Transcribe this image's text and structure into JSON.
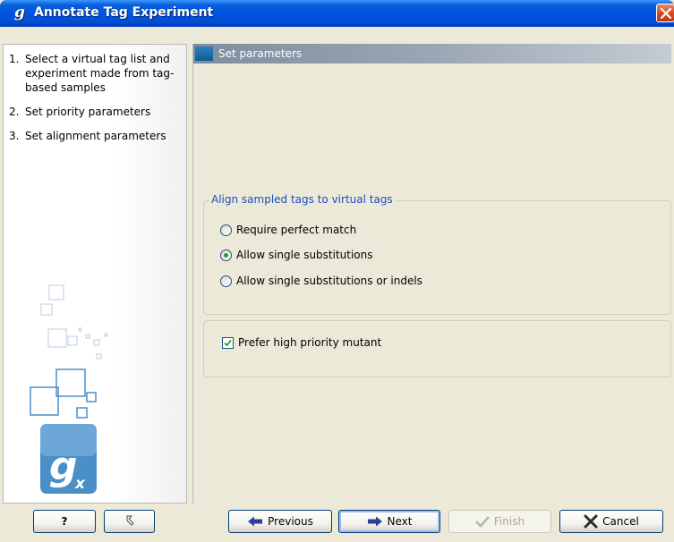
{
  "window": {
    "title": "Annotate Tag Experiment",
    "app_icon_glyph": "g",
    "app_icon": "clc-genomics-g-icon",
    "close_icon": "close-x-icon"
  },
  "steps": [
    {
      "num": "1.",
      "label": "Select a virtual tag list and experiment made from tag-based samples"
    },
    {
      "num": "2.",
      "label": "Set priority parameters"
    },
    {
      "num": "3.",
      "label": "Set alignment parameters"
    }
  ],
  "section": {
    "title": "Set parameters"
  },
  "alignment_group": {
    "legend": "Align sampled tags to virtual tags",
    "options": [
      {
        "label": "Require perfect match",
        "selected": false
      },
      {
        "label": "Allow single substitutions",
        "selected": true
      },
      {
        "label": "Allow single substitutions or indels",
        "selected": false
      }
    ]
  },
  "priority_option": {
    "label": "Prefer high priority mutant",
    "checked": true
  },
  "buttons": {
    "help": "?",
    "reset_icon": "reset-arrow-icon",
    "previous": "Previous",
    "next": "Next",
    "finish": "Finish",
    "cancel": "Cancel"
  },
  "colors": {
    "titlebar": "#0054e3",
    "section_header": "#8c9aab",
    "group_legend": "#1d4fbf",
    "radio_dot": "#21a121",
    "logo_tile": "#4b8fc9"
  }
}
